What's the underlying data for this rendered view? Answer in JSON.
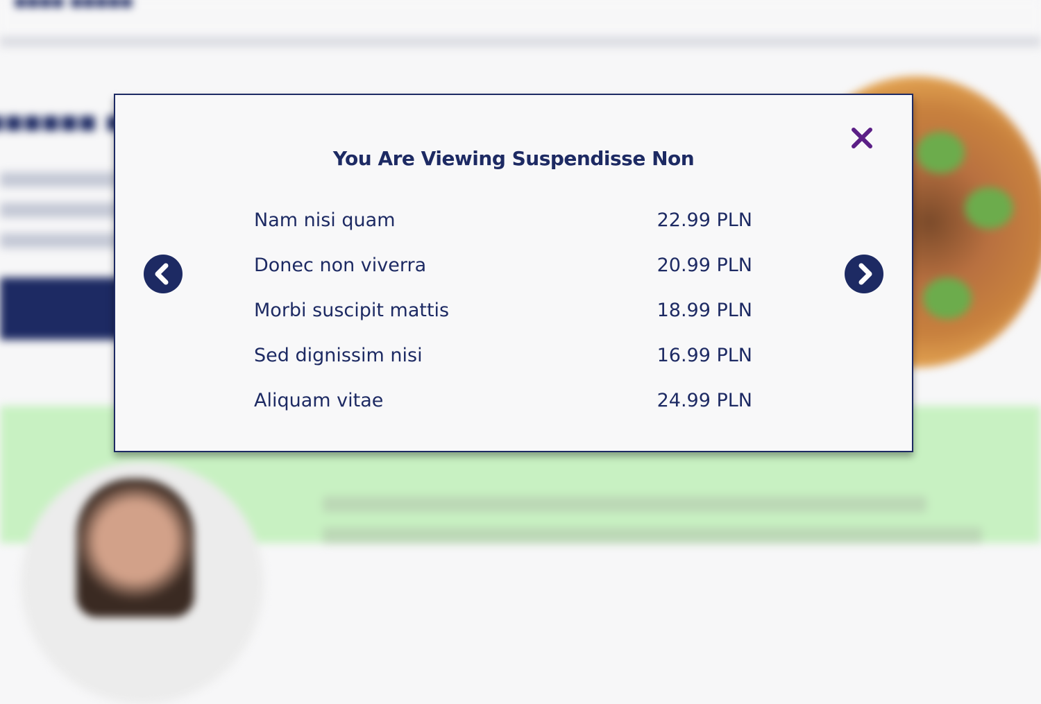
{
  "modal": {
    "title": "You Are Viewing Suspendisse Non",
    "close_icon": "close-icon",
    "prev_icon": "chevron-left-icon",
    "next_icon": "chevron-right-icon",
    "colors": {
      "accent": "#1d2a63",
      "close": "#5b1f86",
      "background": "#f8f8f9"
    },
    "items": [
      {
        "name": "Nam nisi quam",
        "price": "22.99 PLN"
      },
      {
        "name": "Donec non viverra",
        "price": "20.99 PLN"
      },
      {
        "name": "Morbi suscipit mattis",
        "price": "18.99 PLN"
      },
      {
        "name": "Sed dignissim nisi",
        "price": "16.99 PLN"
      },
      {
        "name": "Aliquam vitae",
        "price": "24.99 PLN"
      }
    ]
  }
}
